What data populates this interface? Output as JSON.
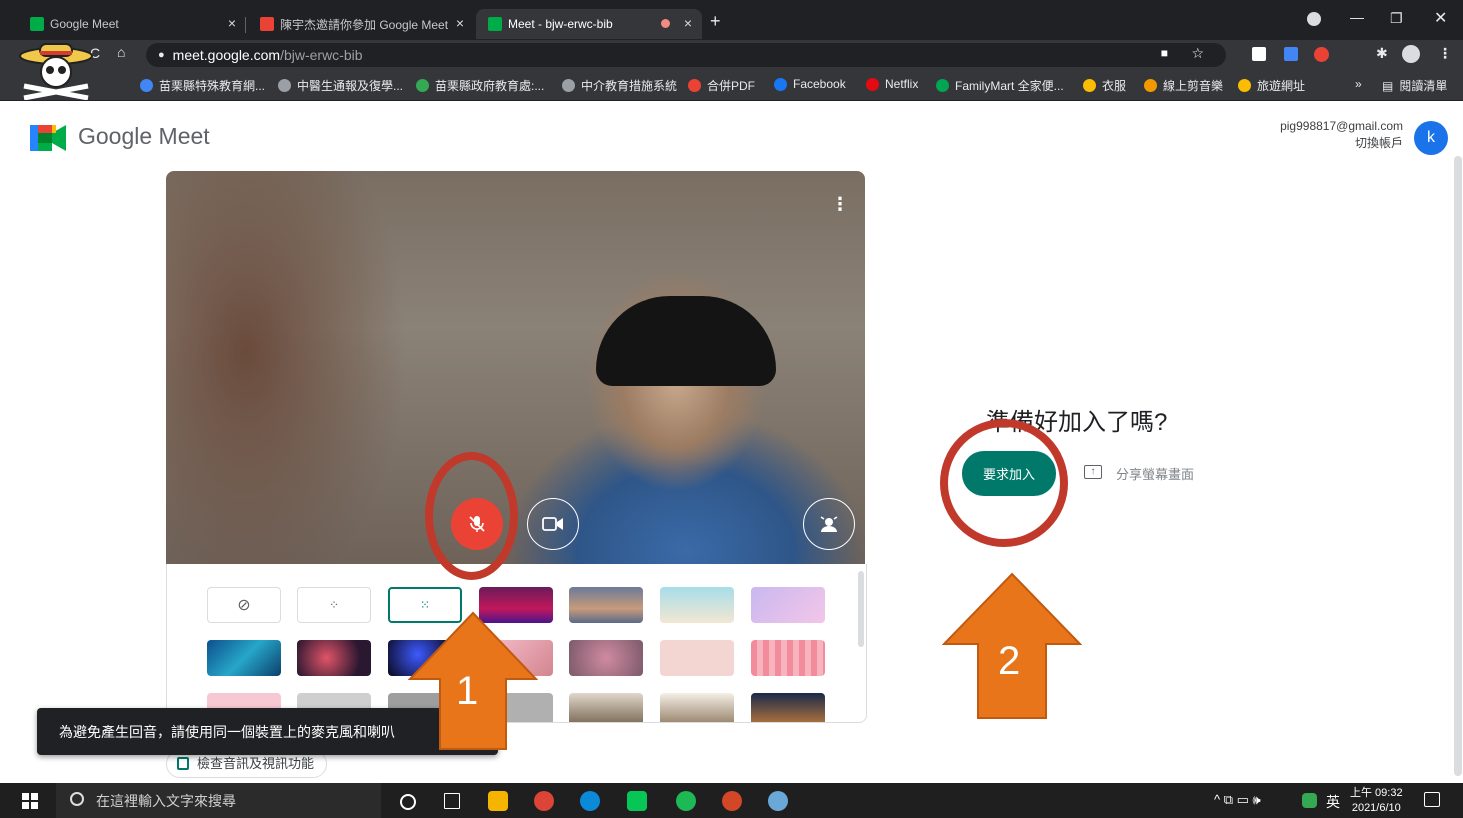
{
  "browser": {
    "tabs": [
      {
        "title": "Google Meet",
        "active": false
      },
      {
        "title": "陳宇杰邀請你參加 Google Meet",
        "active": false
      },
      {
        "title": "Meet - bjw-erwc-bib",
        "active": true
      }
    ],
    "new_tab": "+",
    "url_domain": "meet.google.com",
    "url_path": "/bjw-erwc-bib",
    "bookmarks": [
      {
        "label": "苗栗縣特殊教育網...",
        "color": "#4285f4"
      },
      {
        "label": "中醫生通報及復學...",
        "color": "#9aa0a6"
      },
      {
        "label": "苗栗縣政府教育處:...",
        "color": "#34a853"
      },
      {
        "label": "中介教育措施系統",
        "color": "#9aa0a6"
      },
      {
        "label": "合併PDF",
        "color": "#ea4335"
      },
      {
        "label": "Facebook",
        "color": "#1877f2"
      },
      {
        "label": "Netflix",
        "color": "#e50914"
      },
      {
        "label": "FamilyMart 全家便...",
        "color": "#00a651"
      },
      {
        "label": "衣服",
        "color": "#fbbc04"
      },
      {
        "label": "線上剪音樂",
        "color": "#f29900"
      },
      {
        "label": "旅遊網址",
        "color": "#fbbc04"
      }
    ],
    "bookmarks_overflow": "»",
    "reading_list": "閱讀清單"
  },
  "page": {
    "brand": "Google Meet",
    "account_email": "pig998817@gmail.com",
    "account_switch": "切換帳戶",
    "avatar_letter": "k",
    "ready_title": "準備好加入了嗎?",
    "join_button": "要求加入",
    "share_screen": "分享螢幕畫面",
    "toast": "為避免產生回音，請使用同一個裝置上的麥克風和喇叭",
    "check_av": "檢查音訊及視訊功能",
    "colors": {
      "accent": "#00796b",
      "mic_off": "#ea4335",
      "annotation": "#c0392b",
      "arrow": "#e8751a"
    }
  },
  "annotations": {
    "arrow_1": "1",
    "arrow_2": "2"
  },
  "taskbar": {
    "search_placeholder": "在這裡輸入文字來搜尋",
    "ime": "英",
    "time": "上午 09:32",
    "date": "2021/6/10",
    "tray": "^ ⧉ ▭ 🕪"
  }
}
